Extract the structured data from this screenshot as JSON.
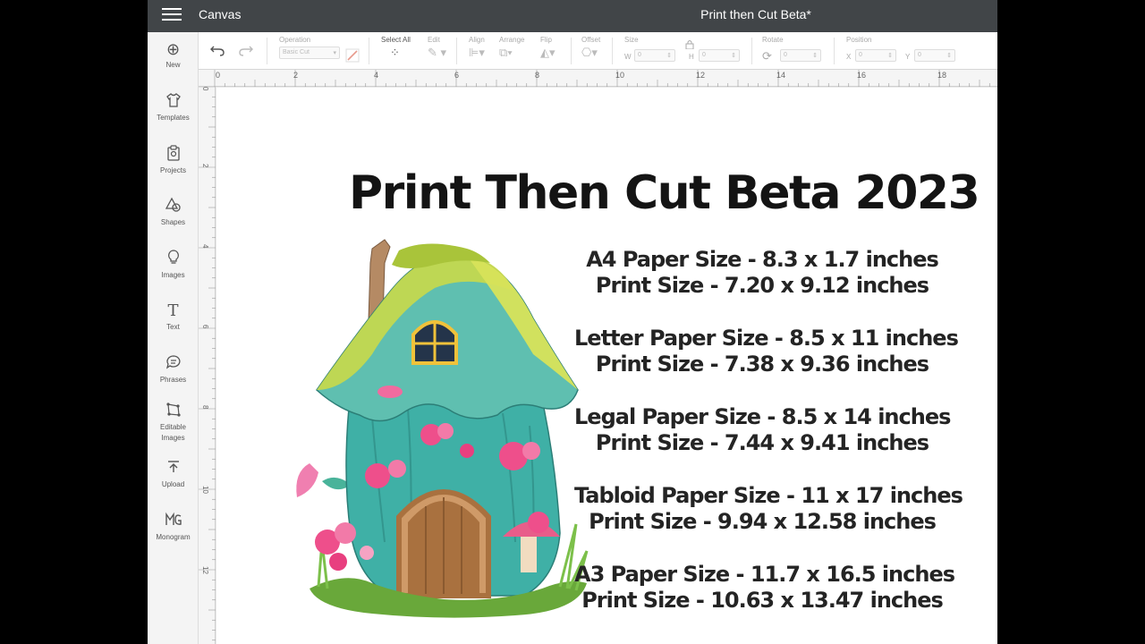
{
  "titlebar": {
    "app_name": "Canvas",
    "document_title": "Print then Cut Beta*"
  },
  "sidebar": {
    "items": [
      {
        "label": "New",
        "icon": "plus-circle-icon"
      },
      {
        "label": "Templates",
        "icon": "tshirt-icon"
      },
      {
        "label": "Projects",
        "icon": "clipboard-icon"
      },
      {
        "label": "Shapes",
        "icon": "shapes-icon"
      },
      {
        "label": "Images",
        "icon": "lightbulb-icon"
      },
      {
        "label": "Text",
        "icon": "text-icon"
      },
      {
        "label": "Phrases",
        "icon": "speech-bubble-icon"
      },
      {
        "label": "Editable",
        "label2": "Images",
        "icon": "editable-images-icon"
      },
      {
        "label": "Upload",
        "icon": "upload-icon"
      },
      {
        "label": "Monogram",
        "icon": "monogram-icon"
      }
    ]
  },
  "toolbar": {
    "operation_label": "Operation",
    "operation_value": "Basic Cut",
    "select_all_label": "Select All",
    "edit_label": "Edit",
    "align_label": "Align",
    "arrange_label": "Arrange",
    "flip_label": "Flip",
    "offset_label": "Offset",
    "size_label": "Size",
    "rotate_label": "Rotate",
    "position_label": "Position",
    "w_label": "W",
    "h_label": "H",
    "x_label": "X",
    "y_label": "Y",
    "w_value": "0",
    "h_value": "0",
    "rotate_value": "0",
    "x_value": "0",
    "y_value": "0"
  },
  "ruler": {
    "top_numbers": [
      "0",
      "2",
      "4",
      "6",
      "8",
      "10",
      "12",
      "14",
      "16",
      "18"
    ],
    "left_numbers": [
      "0",
      "2",
      "4",
      "6",
      "8",
      "10",
      "12"
    ]
  },
  "canvas": {
    "headline": "Print Then Cut Beta 2023",
    "sizes": [
      {
        "paper": "A4 Paper Size - 8.3 x 1.7 inches",
        "print": "Print Size - 7.20 x 9.12 inches"
      },
      {
        "paper": "Letter Paper Size - 8.5 x 11 inches",
        "print": "Print Size - 7.38 x 9.36 inches"
      },
      {
        "paper": "Legal Paper Size - 8.5 x 14 inches",
        "print": "Print Size - 7.44 x 9.41 inches"
      },
      {
        "paper": "Tabloid Paper Size - 11 x 17 inches",
        "print": "Print Size - 9.94 x 12.58 inches"
      },
      {
        "paper": "A3 Paper Size - 11.7 x 16.5 inches",
        "print": "Print Size - 10.63 x 13.47 inches"
      }
    ]
  },
  "colors": {
    "titlebar": "#414548",
    "sidebar": "#f4f4f4",
    "house_teal": "#3fb0a6",
    "roof_moss": "#c9d94a",
    "door_brown": "#a9713f",
    "flower_pink": "#ee4f8b"
  }
}
